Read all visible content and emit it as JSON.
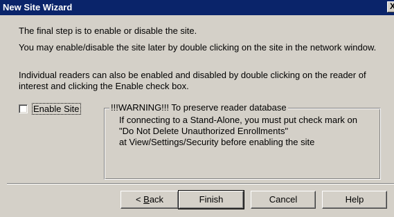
{
  "window": {
    "title": "New Site Wizard",
    "close_glyph": "X"
  },
  "content": {
    "p1": "The final step is to enable or disable the site.",
    "p2": "You may enable/disable the site later by double clicking on the site in the network window.",
    "p3": "Individual readers can also be enabled and disabled by double clicking on the reader of interest and clicking the Enable check box."
  },
  "enable_site": {
    "label": "Enable Site",
    "checked": false
  },
  "warning": {
    "legend": "!!!WARNING!!! To preserve reader database",
    "lines": [
      "If connecting to a Stand-Alone, you must put check mark on",
      "\"Do Not Delete Unauthorized Enrollments\"",
      "at View/Settings/Security before enabling the site"
    ]
  },
  "buttons": {
    "back_prefix": "< ",
    "back_mnemonic": "B",
    "back_rest": "ack",
    "finish": "Finish",
    "cancel": "Cancel",
    "help": "Help"
  }
}
